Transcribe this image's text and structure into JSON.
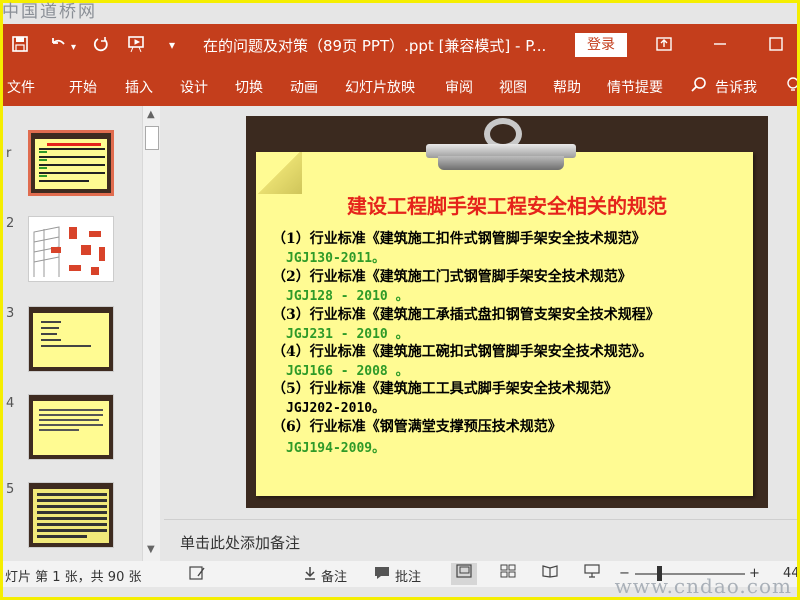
{
  "watermark": {
    "top": "中国道桥网",
    "bottom": "www.cndao.com"
  },
  "titlebar": {
    "icons": [
      "save-icon",
      "undo-icon",
      "redo-icon",
      "start-from-beginning-icon",
      "customize-toolbar-icon"
    ],
    "title": "在的问题及对策（89页 PPT）.ppt [兼容模式]  -  P...",
    "login_label": "登录",
    "restore_glyph": "⧉",
    "maximize_glyph": "☐"
  },
  "ribbon": {
    "tabs": [
      "文件",
      "开始",
      "插入",
      "设计",
      "切换",
      "动画",
      "幻灯片放映",
      "审阅",
      "视图",
      "帮助",
      "情节提要"
    ],
    "tellme_label": "告诉我"
  },
  "thumbnails": {
    "numbers": [
      "1",
      "2",
      "3",
      "4",
      "5"
    ]
  },
  "slide": {
    "title": "建设工程脚手架工程安全相关的规范",
    "items": [
      {
        "line": "（1）行业标准《建筑施工扣件式钢管脚手架安全技术规范》",
        "code": "JGJ130-2011。"
      },
      {
        "line": "（2）行业标准《建筑施工门式钢管脚手架安全技术规范》",
        "code": "JGJ128 - 2010 。"
      },
      {
        "line": "（3）行业标准《建筑施工承插式盘扣钢管支架安全技术规程》",
        "code": "JGJ231 - 2010 。"
      },
      {
        "line": "（4）行业标准《建筑施工碗扣式钢管脚手架安全技术规范》。",
        "code": "JGJ166 - 2008 。"
      },
      {
        "line": "（5）行业标准《建筑施工工具式脚手架安全技术规范》",
        "code": "JGJ202-2010。"
      },
      {
        "line": "（6）行业标准《钢管满堂支撑预压技术规范》",
        "code": "JGJ194-2009。"
      }
    ]
  },
  "notes": {
    "placeholder": "单击此处添加备注"
  },
  "statusbar": {
    "slide_info": "灯片 第 1 张，共 90 张",
    "notes_label": "备注",
    "comments_label": "批注",
    "zoom_minus": "−",
    "zoom_plus": "+",
    "zoom_value": "44"
  },
  "colors": {
    "accent": "#c43e1c",
    "title_red": "#e5231b",
    "code_green": "#2e9a28",
    "paper": "#fffb93",
    "board": "#3b2a1f"
  }
}
